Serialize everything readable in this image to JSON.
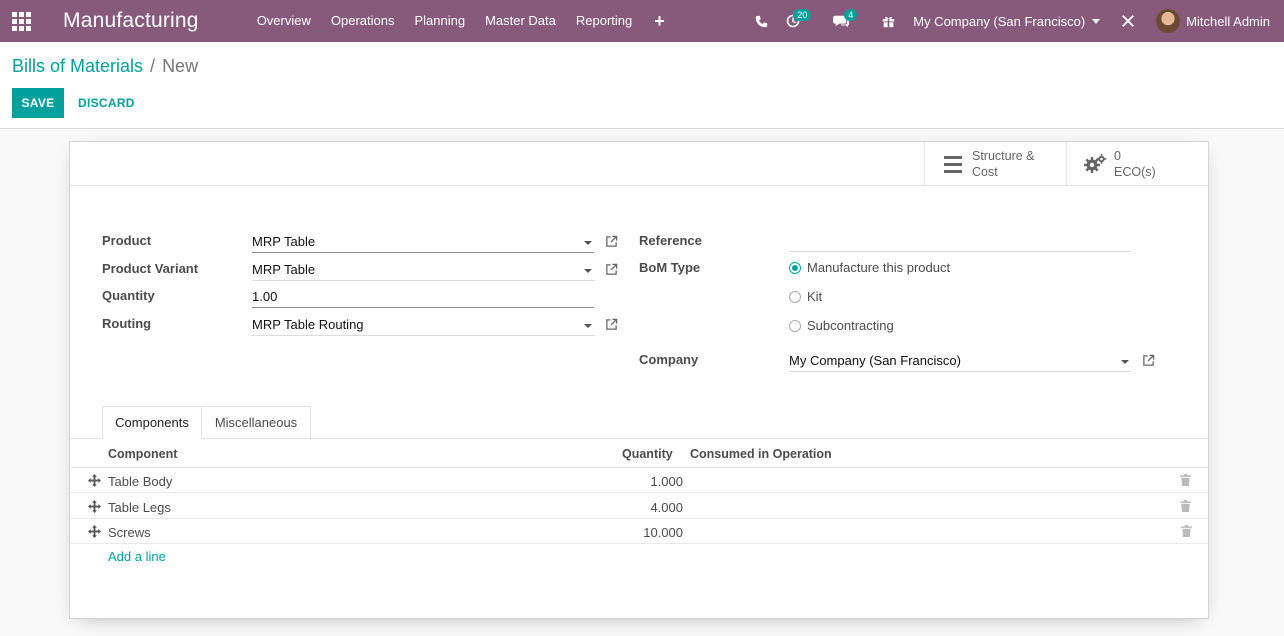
{
  "navbar": {
    "app_title": "Manufacturing",
    "menu": [
      "Overview",
      "Operations",
      "Planning",
      "Master Data",
      "Reporting"
    ],
    "plus": "+",
    "activity_badge": "20",
    "messages_badge": "4",
    "company": "My Company (San Francisco)",
    "user": "Mitchell Admin"
  },
  "breadcrumb": {
    "parent": "Bills of Materials",
    "separator": "/",
    "current": "New"
  },
  "buttons": {
    "save": "SAVE",
    "discard": "DISCARD"
  },
  "stat_buttons": {
    "structure_line1": "Structure &",
    "structure_line2": "Cost",
    "eco_count": "0",
    "eco_label": "ECO(s)"
  },
  "form": {
    "product_label": "Product",
    "product_value": "MRP Table",
    "variant_label": "Product Variant",
    "variant_value": "MRP Table",
    "quantity_label": "Quantity",
    "quantity_value": "1.00",
    "routing_label": "Routing",
    "routing_value": "MRP Table Routing",
    "reference_label": "Reference",
    "reference_value": "",
    "bom_type_label": "BoM Type",
    "bom_type_options": [
      "Manufacture this product",
      "Kit",
      "Subcontracting"
    ],
    "bom_type_selected": "Manufacture this product",
    "company_label": "Company",
    "company_value": "My Company (San Francisco)"
  },
  "tabs": [
    "Components",
    "Miscellaneous"
  ],
  "components_table": {
    "headers": [
      "Component",
      "Quantity",
      "Consumed in Operation"
    ],
    "rows": [
      {
        "component": "Table Body",
        "quantity": "1.000",
        "operation": ""
      },
      {
        "component": "Table Legs",
        "quantity": "4.000",
        "operation": ""
      },
      {
        "component": "Screws",
        "quantity": "10.000",
        "operation": ""
      }
    ],
    "add_line": "Add a line"
  },
  "colors": {
    "brand": "#875a7b",
    "accent": "#00a09d"
  }
}
